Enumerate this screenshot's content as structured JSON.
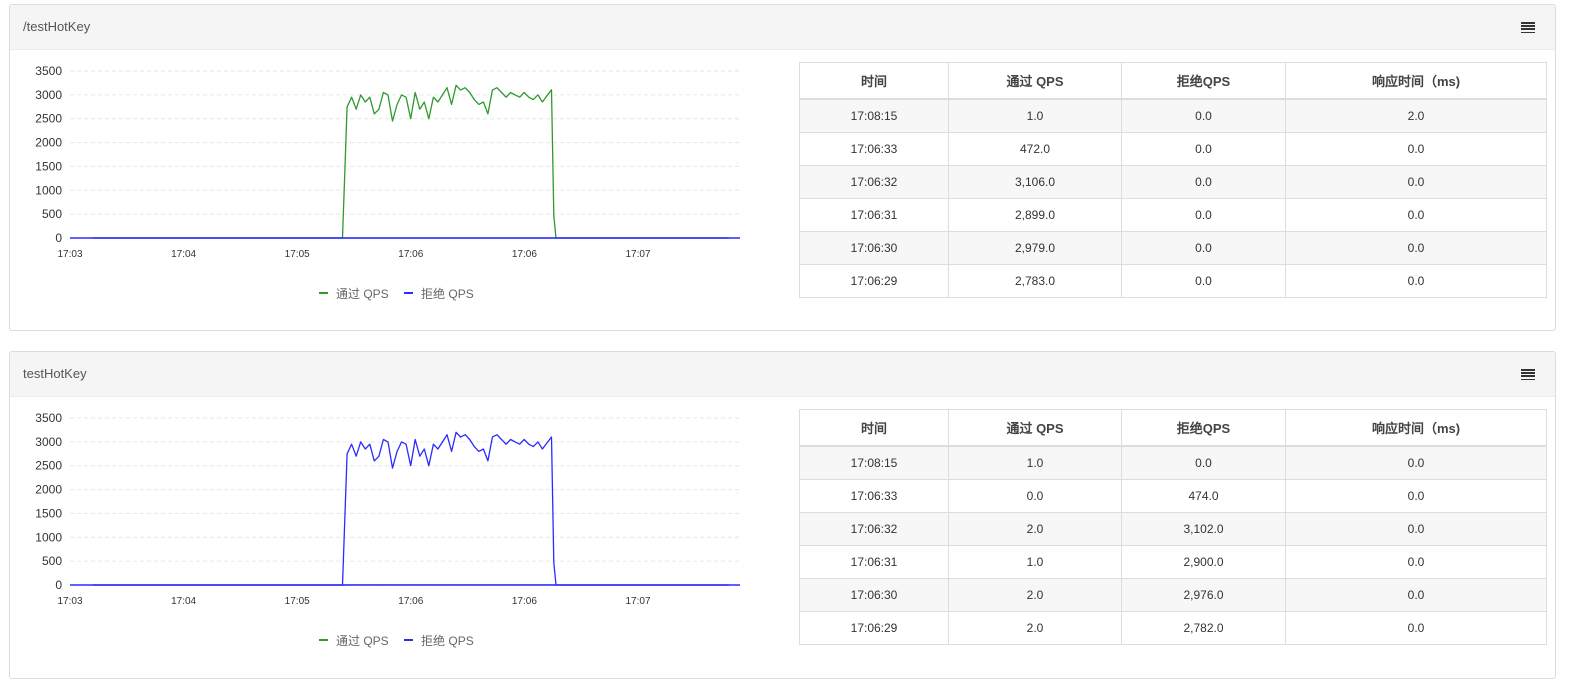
{
  "panels": [
    {
      "title": "/testHotKey",
      "legend": [
        {
          "label": "通过 QPS",
          "color": "#2e9a2e"
        },
        {
          "label": "拒绝 QPS",
          "color": "#2b2bff"
        }
      ],
      "table": {
        "headers": [
          "时间",
          "通过 QPS",
          "拒绝QPS",
          "响应时间（ms)"
        ],
        "rows": [
          [
            "17:08:15",
            "1.0",
            "0.0",
            "2.0"
          ],
          [
            "17:06:33",
            "472.0",
            "0.0",
            "0.0"
          ],
          [
            "17:06:32",
            "3,106.0",
            "0.0",
            "0.0"
          ],
          [
            "17:06:31",
            "2,899.0",
            "0.0",
            "0.0"
          ],
          [
            "17:06:30",
            "2,979.0",
            "0.0",
            "0.0"
          ],
          [
            "17:06:29",
            "2,783.0",
            "0.0",
            "0.0"
          ]
        ]
      }
    },
    {
      "title": "testHotKey",
      "legend": [
        {
          "label": "通过 QPS",
          "color": "#2e9a2e"
        },
        {
          "label": "拒绝 QPS",
          "color": "#2b2bff"
        }
      ],
      "table": {
        "headers": [
          "时间",
          "通过 QPS",
          "拒绝QPS",
          "响应时间（ms)"
        ],
        "rows": [
          [
            "17:08:15",
            "1.0",
            "0.0",
            "0.0"
          ],
          [
            "17:06:33",
            "0.0",
            "474.0",
            "0.0"
          ],
          [
            "17:06:32",
            "2.0",
            "3,102.0",
            "0.0"
          ],
          [
            "17:06:31",
            "1.0",
            "2,900.0",
            "0.0"
          ],
          [
            "17:06:30",
            "2.0",
            "2,976.0",
            "0.0"
          ],
          [
            "17:06:29",
            "2.0",
            "2,782.0",
            "0.0"
          ]
        ]
      }
    }
  ],
  "chart_data": [
    {
      "type": "line",
      "title": "",
      "xlabel": "",
      "ylabel": "",
      "ylim": [
        0,
        3500
      ],
      "yticks": [
        0,
        500,
        1000,
        1500,
        2000,
        2500,
        3000,
        3500
      ],
      "xtick_labels": [
        "17:03",
        "17:04",
        "17:05",
        "17:06",
        "17:06",
        "17:07"
      ],
      "grid": true,
      "legend_position": "bottom",
      "x": [
        "17:03:10",
        "17:04:00",
        "17:05:00",
        "17:05:02",
        "17:05:04",
        "17:05:06",
        "17:05:08",
        "17:05:10",
        "17:05:12",
        "17:05:14",
        "17:05:16",
        "17:05:18",
        "17:05:20",
        "17:05:22",
        "17:05:24",
        "17:05:26",
        "17:05:28",
        "17:05:30",
        "17:05:32",
        "17:05:34",
        "17:05:36",
        "17:05:38",
        "17:05:40",
        "17:05:42",
        "17:05:44",
        "17:05:46",
        "17:05:48",
        "17:05:50",
        "17:05:52",
        "17:05:54",
        "17:05:56",
        "17:05:58",
        "17:06:00",
        "17:06:02",
        "17:06:04",
        "17:06:06",
        "17:06:08",
        "17:06:10",
        "17:06:12",
        "17:06:14",
        "17:06:16",
        "17:06:18",
        "17:06:20",
        "17:06:22",
        "17:06:24",
        "17:06:26",
        "17:06:28",
        "17:06:30",
        "17:06:32",
        "17:06:33",
        "17:06:34",
        "17:07:00",
        "17:07:50"
      ],
      "series": [
        {
          "name": "通过 QPS",
          "color": "#2e9a2e",
          "values": [
            0,
            0,
            0,
            2750,
            2950,
            2700,
            3000,
            2850,
            2950,
            2600,
            2700,
            3050,
            3000,
            2450,
            2800,
            3000,
            2950,
            2500,
            3050,
            2700,
            2850,
            2500,
            2950,
            2850,
            3000,
            3150,
            2800,
            3200,
            3100,
            3150,
            3050,
            2900,
            2800,
            2850,
            2600,
            3100,
            3150,
            3050,
            2950,
            3050,
            3000,
            2950,
            3050,
            2950,
            2900,
            3000,
            2850,
            2979,
            3106,
            472,
            0,
            0,
            0
          ]
        },
        {
          "name": "拒绝 QPS",
          "color": "#2b2bff",
          "values": [
            0,
            0,
            0,
            0,
            0,
            0,
            0,
            0,
            0,
            0,
            0,
            0,
            0,
            0,
            0,
            0,
            0,
            0,
            0,
            0,
            0,
            0,
            0,
            0,
            0,
            0,
            0,
            0,
            0,
            0,
            0,
            0,
            0,
            0,
            0,
            0,
            0,
            0,
            0,
            0,
            0,
            0,
            0,
            0,
            0,
            0,
            0,
            0,
            0,
            0,
            0,
            0,
            0
          ]
        }
      ]
    },
    {
      "type": "line",
      "title": "",
      "xlabel": "",
      "ylabel": "",
      "ylim": [
        0,
        3500
      ],
      "yticks": [
        0,
        500,
        1000,
        1500,
        2000,
        2500,
        3000,
        3500
      ],
      "xtick_labels": [
        "17:03",
        "17:04",
        "17:05",
        "17:06",
        "17:06",
        "17:07"
      ],
      "grid": true,
      "legend_position": "bottom",
      "x": [
        "17:03:10",
        "17:04:00",
        "17:05:00",
        "17:05:02",
        "17:05:04",
        "17:05:06",
        "17:05:08",
        "17:05:10",
        "17:05:12",
        "17:05:14",
        "17:05:16",
        "17:05:18",
        "17:05:20",
        "17:05:22",
        "17:05:24",
        "17:05:26",
        "17:05:28",
        "17:05:30",
        "17:05:32",
        "17:05:34",
        "17:05:36",
        "17:05:38",
        "17:05:40",
        "17:05:42",
        "17:05:44",
        "17:05:46",
        "17:05:48",
        "17:05:50",
        "17:05:52",
        "17:05:54",
        "17:05:56",
        "17:05:58",
        "17:06:00",
        "17:06:02",
        "17:06:04",
        "17:06:06",
        "17:06:08",
        "17:06:10",
        "17:06:12",
        "17:06:14",
        "17:06:16",
        "17:06:18",
        "17:06:20",
        "17:06:22",
        "17:06:24",
        "17:06:26",
        "17:06:28",
        "17:06:30",
        "17:06:32",
        "17:06:33",
        "17:06:34",
        "17:07:00",
        "17:07:50"
      ],
      "series": [
        {
          "name": "通过 QPS",
          "color": "#2e9a2e",
          "values": [
            0,
            0,
            0,
            2,
            1,
            2,
            2,
            1,
            2,
            2,
            1,
            2,
            2,
            1,
            2,
            2,
            1,
            2,
            2,
            1,
            2,
            2,
            1,
            2,
            2,
            1,
            2,
            2,
            1,
            2,
            2,
            1,
            2,
            2,
            1,
            2,
            2,
            1,
            2,
            2,
            1,
            2,
            2,
            1,
            2,
            2,
            1,
            2,
            2,
            0,
            0,
            0,
            0
          ]
        },
        {
          "name": "拒绝 QPS",
          "color": "#2b2bff",
          "values": [
            0,
            0,
            0,
            2750,
            2950,
            2700,
            3000,
            2850,
            2950,
            2600,
            2700,
            3050,
            3000,
            2450,
            2800,
            3000,
            2950,
            2500,
            3050,
            2700,
            2850,
            2500,
            2950,
            2850,
            3000,
            3150,
            2800,
            3200,
            3100,
            3150,
            3050,
            2900,
            2800,
            2850,
            2600,
            3100,
            3150,
            3050,
            2950,
            3050,
            3000,
            2950,
            3050,
            2950,
            2900,
            3000,
            2850,
            2976,
            3102,
            474,
            0,
            0,
            0
          ]
        }
      ]
    }
  ]
}
